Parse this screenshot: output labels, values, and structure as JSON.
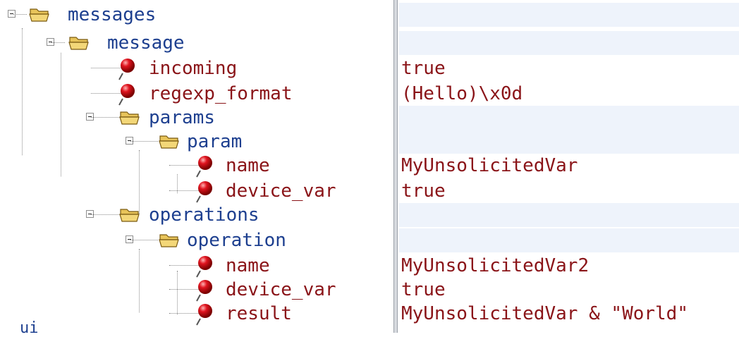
{
  "tree": {
    "nodes": [
      {
        "type": "folder",
        "label": "messages"
      },
      {
        "type": "folder",
        "label": "message"
      },
      {
        "type": "leaf",
        "label": "incoming",
        "value": "true"
      },
      {
        "type": "leaf",
        "label": "regexp_format",
        "value": "(Hello)\\x0d"
      },
      {
        "type": "folder",
        "label": "params"
      },
      {
        "type": "folder",
        "label": "param"
      },
      {
        "type": "leaf",
        "label": "name",
        "value": "MyUnsolicitedVar"
      },
      {
        "type": "leaf",
        "label": "device_var",
        "value": "true"
      },
      {
        "type": "folder",
        "label": "operations"
      },
      {
        "type": "folder",
        "label": "operation"
      },
      {
        "type": "leaf",
        "label": "name",
        "value": "MyUnsolicitedVar2"
      },
      {
        "type": "leaf",
        "label": "device_var",
        "value": "true"
      },
      {
        "type": "leaf",
        "label": "result",
        "value": "MyUnsolicitedVar & \"World\""
      }
    ],
    "bottom_label": "ui"
  },
  "colors": {
    "folder_text": "#1d3f8f",
    "leaf_text": "#8a1418",
    "value_bg_folder": "#eef3fb",
    "bullet": "#e0141f",
    "folder_icon": "#f3d778"
  },
  "icons": {
    "folder": "folder-open-icon",
    "leaf": "red-bullet-icon",
    "toggle": "collapse-minus-icon"
  }
}
